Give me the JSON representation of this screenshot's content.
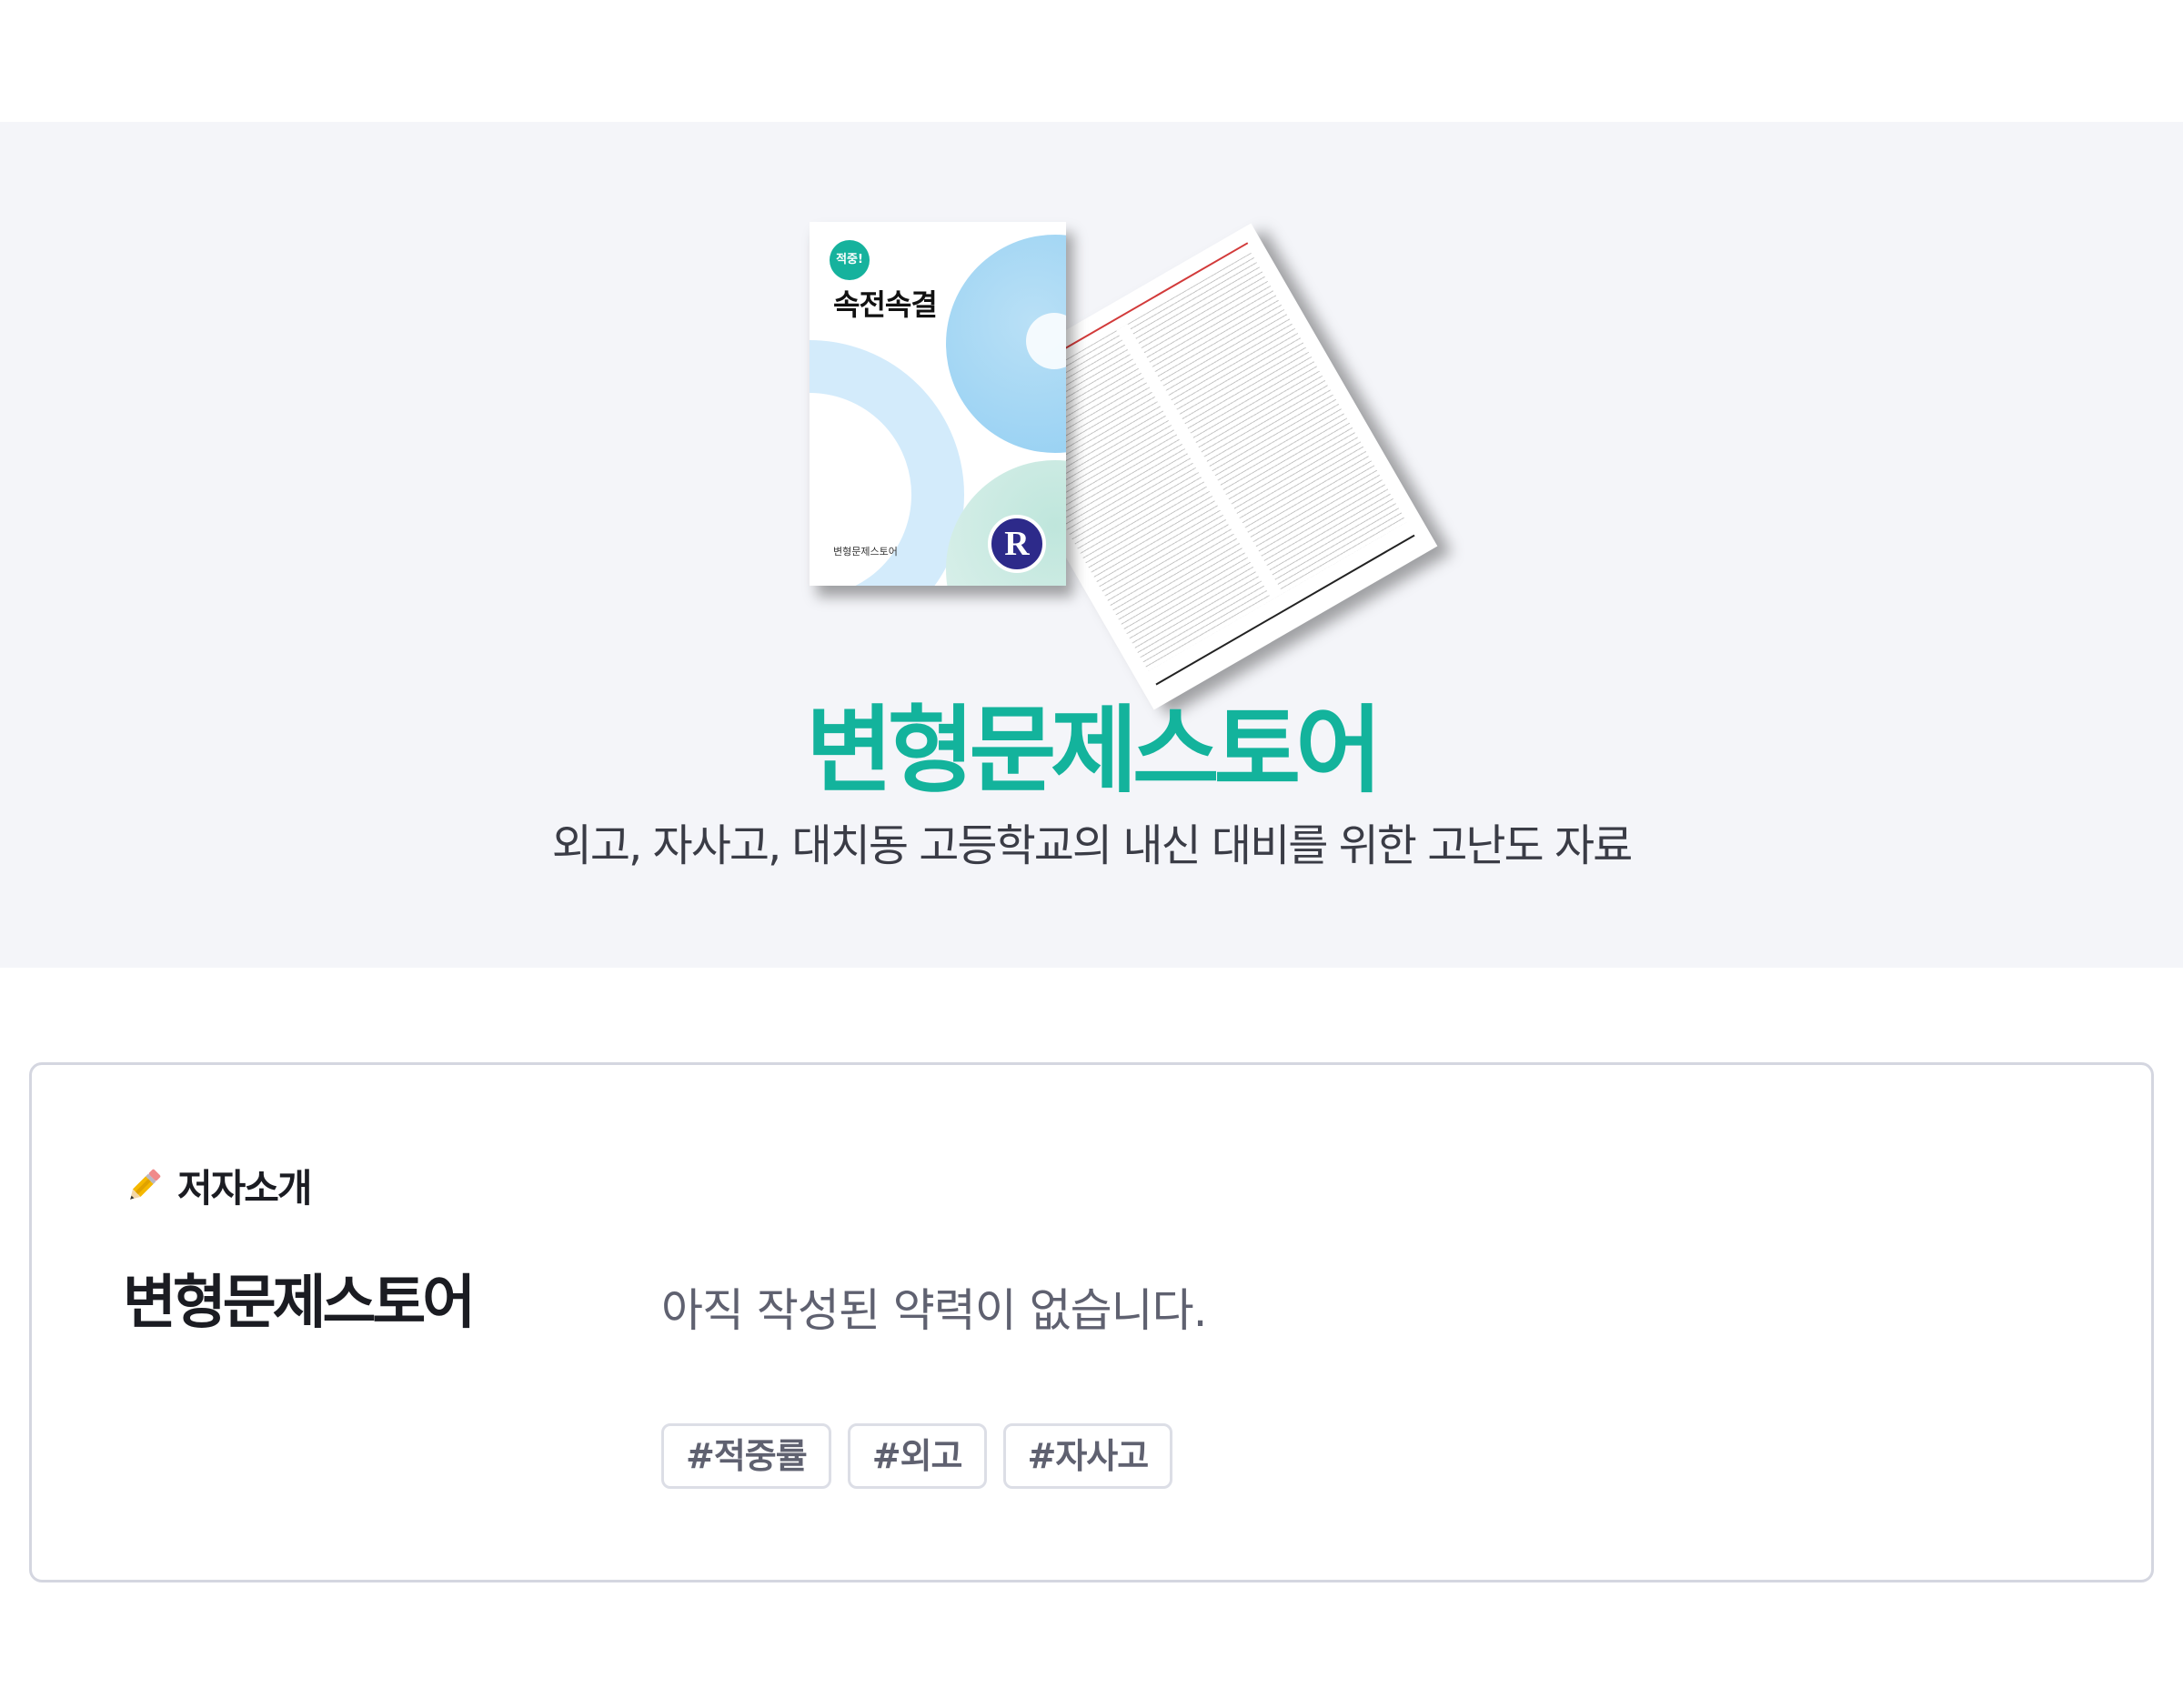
{
  "hero": {
    "book_badge": "적중!",
    "book_title": "속전속결",
    "book_publisher": "변형문제스토어",
    "book_logo_letter": "R",
    "title": "변형문제스토어",
    "subtitle": "외고, 자사고, 대치동 고등학교의 내신 대비를 위한 고난도 자료"
  },
  "author_section": {
    "label": "저자소개",
    "icon": "pencil-icon",
    "name": "변형문제스토어",
    "bio": "아직 작성된 약력이 없습니다.",
    "tags": [
      "#적중률",
      "#외고",
      "#자사고"
    ]
  },
  "colors": {
    "accent": "#13b39c",
    "hero_bg": "#f4f5f9",
    "text_muted": "#5f6170"
  }
}
